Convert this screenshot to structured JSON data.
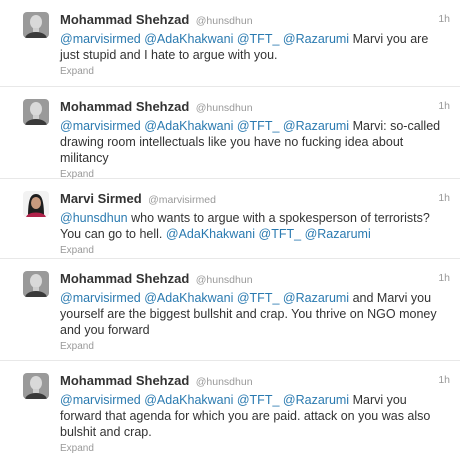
{
  "tweets": [
    {
      "fullname": "Mohammad Shehzad",
      "username": "@hunsdhun",
      "time": "1h",
      "mentions": [
        "@marvisirmed",
        "@AdaKhakwani",
        "@TFT_",
        "@Razarumi"
      ],
      "text": "Marvi you are just stupid and I hate to argue with you.",
      "expand": "Expand",
      "avatar": "man-avatar"
    },
    {
      "fullname": "Mohammad Shehzad",
      "username": "@hunsdhun",
      "time": "1h",
      "mentions": [
        "@marvisirmed",
        "@AdaKhakwani",
        "@TFT_",
        "@Razarumi"
      ],
      "text": "Marvi: so-called drawing room intellectuals like you have no fucking idea about militancy",
      "expand": "Expand",
      "avatar": "man-avatar"
    },
    {
      "fullname": "Marvi Sirmed",
      "username": "@marvisirmed",
      "time": "1h",
      "lead_mention": "@hunsdhun",
      "text": "who wants to argue with a spokesperson of terrorists? You can go to hell.",
      "trail_mentions": [
        "@AdaKhakwani",
        "@TFT_",
        "@Razarumi"
      ],
      "expand": "Expand",
      "avatar": "woman-avatar"
    },
    {
      "fullname": "Mohammad Shehzad",
      "username": "@hunsdhun",
      "time": "1h",
      "mentions": [
        "@marvisirmed",
        "@AdaKhakwani",
        "@TFT_",
        "@Razarumi"
      ],
      "text": "and Marvi you yourself are the biggest bullshit and crap. You thrive on NGO money and you forward",
      "expand": "Expand",
      "avatar": "man-avatar"
    },
    {
      "fullname": "Mohammad Shehzad",
      "username": "@hunsdhun",
      "time": "1h",
      "mentions": [
        "@marvisirmed",
        "@AdaKhakwani",
        "@TFT_",
        "@Razarumi"
      ],
      "text": "Marvi you forward that agenda for which you are paid. attack on you was also bulshit and crap.",
      "expand": "Expand",
      "avatar": "man-avatar"
    }
  ],
  "colors": {
    "mention": "#2a7ab0",
    "name": "#333333",
    "meta": "#999999",
    "divider": "#e8e8e8"
  }
}
